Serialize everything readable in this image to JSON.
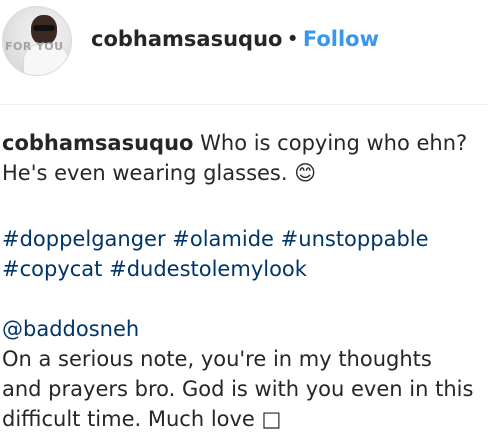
{
  "header": {
    "username": "cobhamsasuquo",
    "separator": "•",
    "follow_label": "Follow",
    "avatar_badge": "FOR YOU"
  },
  "caption": {
    "author": "cobhamsasuquo",
    "line1_text": " Who is copying who ehn?",
    "line2_text": "He's even wearing glasses. 😊"
  },
  "hashtags": {
    "line1": [
      "#doppelganger",
      "#olamide",
      "#unstoppable"
    ],
    "line2": [
      "#copycat",
      "#dudestolemylook"
    ]
  },
  "mention": {
    "handle": "@baddosneh",
    "lines": [
      "On a serious note, you're in my thoughts",
      "and prayers bro. God is with you even in this",
      "difficult time. Much love □"
    ]
  }
}
